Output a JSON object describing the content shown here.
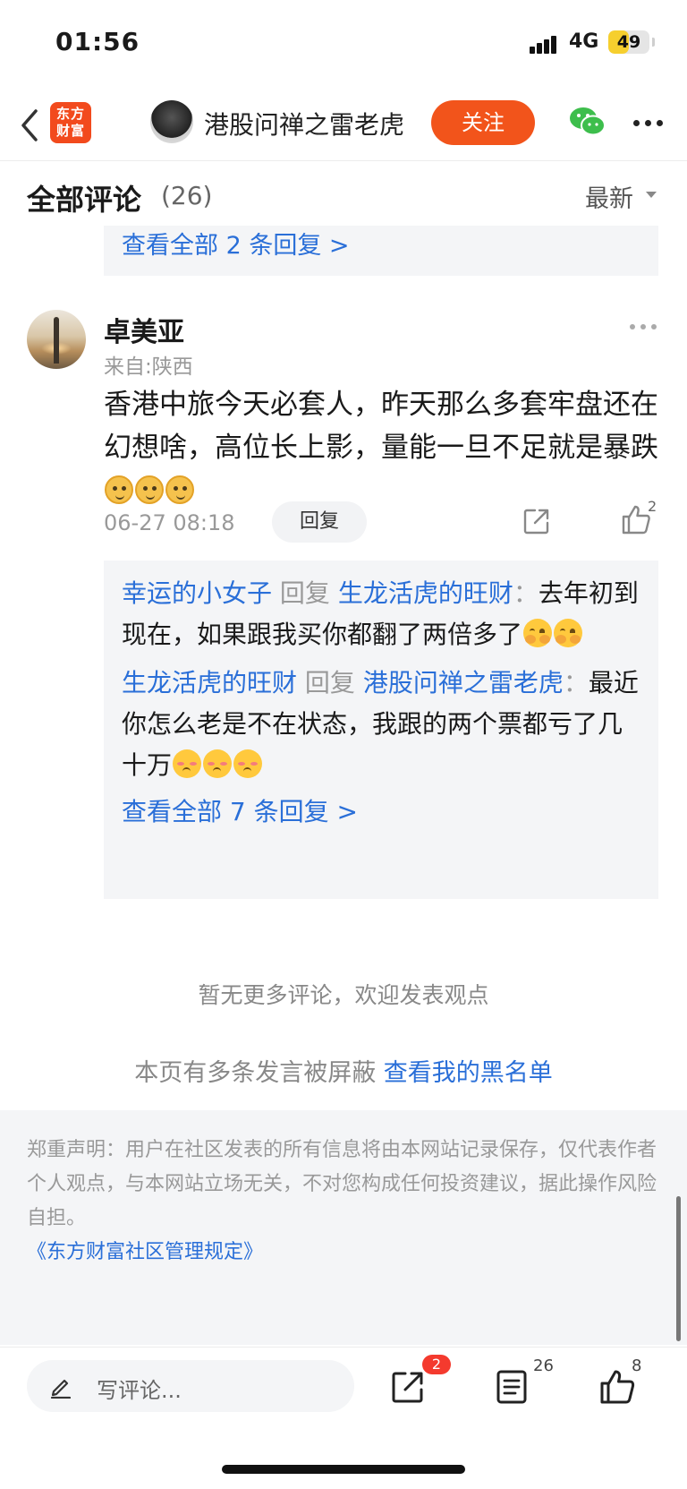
{
  "status_bar": {
    "time": "01:56",
    "network": "4G",
    "battery": "49",
    "battery_level": 0.49
  },
  "nav": {
    "logo_line1": "东方",
    "logo_line2": "财富",
    "author_name": "港股问禅之雷老虎",
    "follow_label": "关注",
    "icons": [
      "back-icon",
      "wechat-icon",
      "more-icon"
    ]
  },
  "comments_header": {
    "title": "全部评论",
    "count": "(26)",
    "sort_label": "最新"
  },
  "prev_reply_box": {
    "view_all": "查看全部 2 条回复 >"
  },
  "comment": {
    "name": "卓美亚",
    "location": "来自:陕西",
    "content": "香港中旅今天必套人，昨天那么多套牢盘还在幻想啥，高位长上影，量能一旦不足就是暴跌",
    "time": "06-27 08:18",
    "reply_label": "回复",
    "like_count": "2",
    "replies": [
      {
        "from": "幸运的小女子",
        "verb": "回复",
        "to": "生龙活虎的旺财",
        "sep": "：",
        "text": "去年初到现在，如果跟我买你都翻了两倍多了"
      },
      {
        "from": "生龙活虎的旺财",
        "verb": "回复",
        "to": "港股问禅之雷老虎",
        "sep": "：",
        "text": "最近你怎么老是不在状态，我跟的两个票都亏了几十万"
      }
    ],
    "view_all_replies": "查看全部 7 条回复 >"
  },
  "footer": {
    "no_more": "暂无更多评论，欢迎发表观点",
    "blocked_text": "本页有多条发言被屏蔽",
    "blocklist_link": "查看我的黑名单",
    "disclaimer": "郑重声明：用户在社区发表的所有信息将由本网站记录保存，仅代表作者个人观点，与本网站立场无关，不对您构成任何投资建议，据此操作风险自担。",
    "rules_link": "《东方财富社区管理规定》"
  },
  "bottom_bar": {
    "write_placeholder": "写评论...",
    "share_badge": "2",
    "comment_count": "26",
    "like_count": "8"
  },
  "colors": {
    "accent": "#f2541b",
    "link": "#2a6fd8",
    "badge": "#f43a2e"
  }
}
